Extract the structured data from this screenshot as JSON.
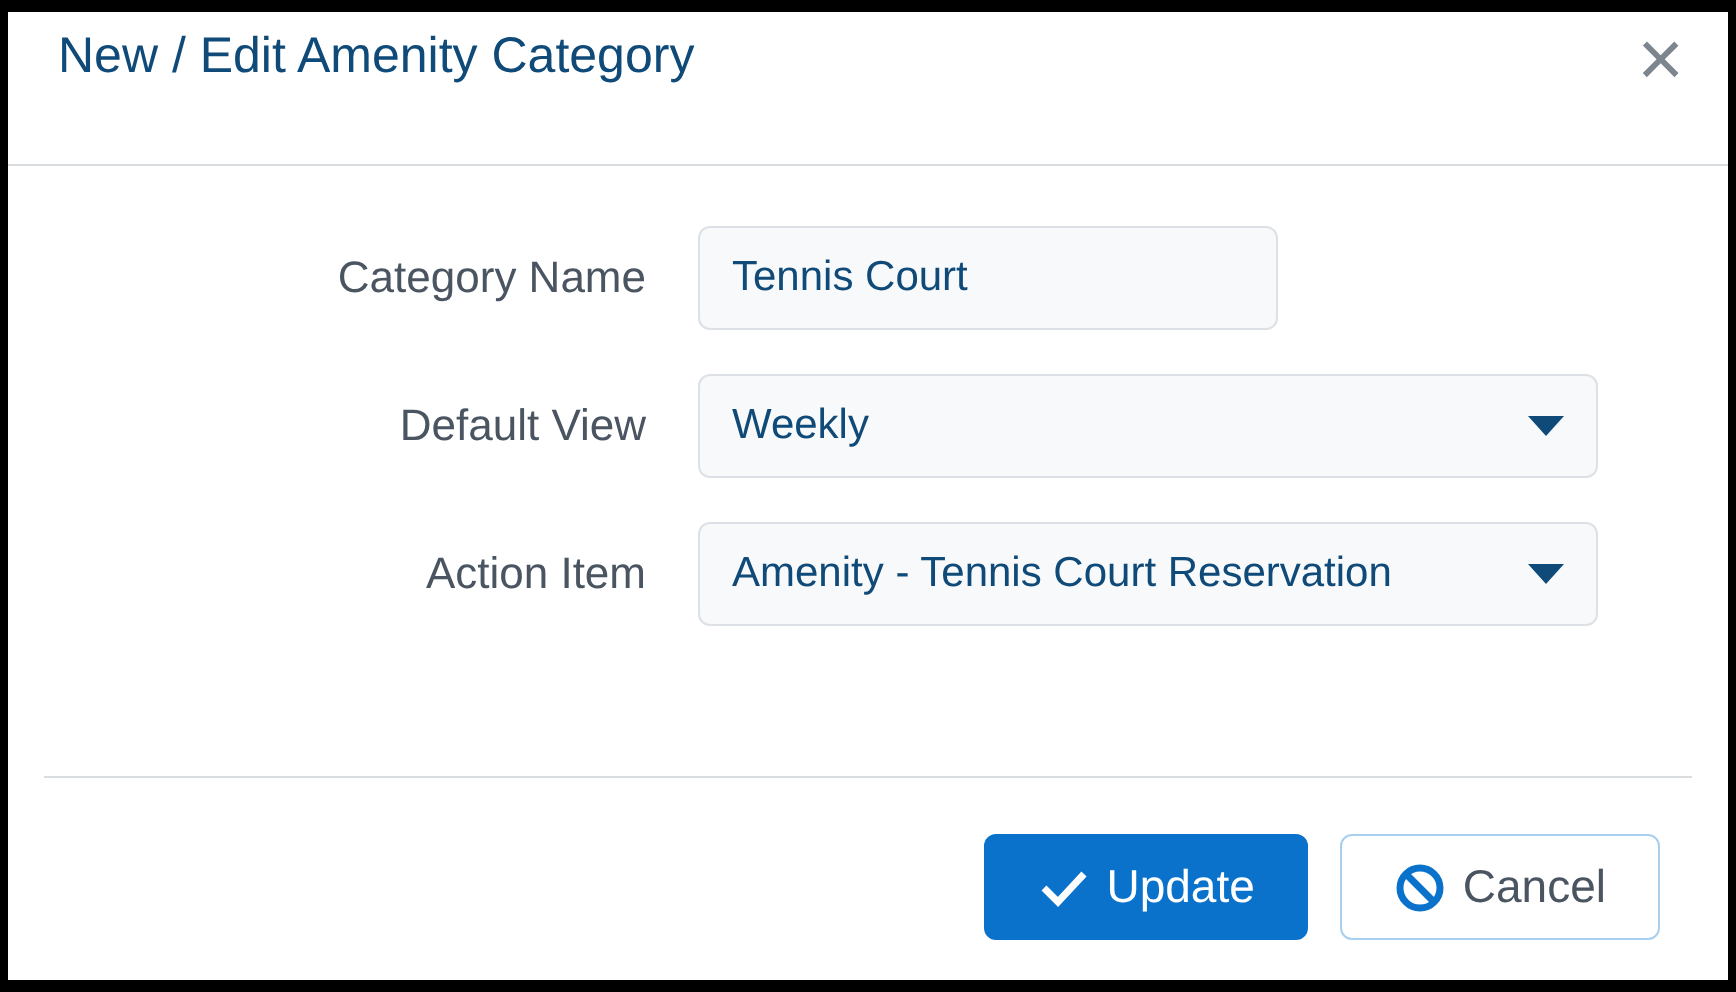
{
  "dialog": {
    "title": "New / Edit Amenity Category",
    "close": "×"
  },
  "fields": [
    {
      "kind": "text",
      "label": "Category Name",
      "value": "Tennis Court"
    },
    {
      "kind": "select",
      "label": "Default View",
      "value": "Weekly"
    },
    {
      "kind": "select",
      "label": "Action Item",
      "value": "Amenity - Tennis Court Reservation"
    }
  ],
  "buttons": [
    {
      "kind": "primary",
      "label": "Update"
    },
    {
      "kind": "secondary",
      "label": "Cancel"
    }
  ]
}
